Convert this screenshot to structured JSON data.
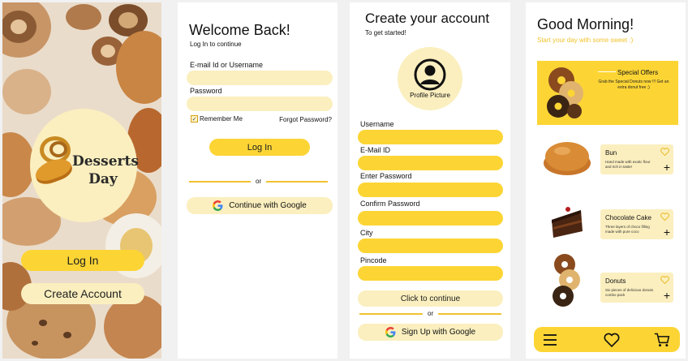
{
  "splash": {
    "brand_line1": "Desserts",
    "brand_line2": "Day",
    "login_label": "Log In",
    "create_label": "Create Account"
  },
  "login": {
    "title": "Welcome Back!",
    "subtitle": "Log In to continue",
    "email_label": "E-mail Id or Username",
    "email_value": "",
    "password_label": "Password",
    "password_value": "",
    "remember_label": "Remember Me",
    "remember_checked": true,
    "forgot_label": "Forgot Password?",
    "login_button": "Log In",
    "or_label": "or",
    "google_button": "Continue with Google"
  },
  "register": {
    "title": "Create your account",
    "subtitle": "To get started!",
    "profile_label": "Profile Picture",
    "fields": [
      {
        "label": "Username",
        "value": ""
      },
      {
        "label": "E-Mail ID",
        "value": ""
      },
      {
        "label": "Enter Password",
        "value": ""
      },
      {
        "label": "Confirm Password",
        "value": ""
      },
      {
        "label": "City",
        "value": ""
      },
      {
        "label": "Pincode",
        "value": ""
      }
    ],
    "continue_button": "Click to continue",
    "or_label": "or",
    "google_button": "Sign Up with Google"
  },
  "home": {
    "greeting": "Good Morning!",
    "greeting_sub": "Start your day with some sweet :)",
    "offer": {
      "title": "Special Offers",
      "description": "Grab the Special Donuts now !!! Get an extra donut free ;)"
    },
    "items": [
      {
        "name": "Bun",
        "description": "Hand made with exotic flour and rich in taste!"
      },
      {
        "name": "Chocolate Cake",
        "description": "Three layers of choco filling made with pure coco"
      },
      {
        "name": "Donuts",
        "description": "Six pieces of delicious donuts combo pack"
      }
    ],
    "nav": [
      "menu-icon",
      "heart-icon",
      "cart-icon"
    ]
  },
  "colors": {
    "accent": "#fcd535",
    "cream": "#fbefbf",
    "sub_text": "#f0c32c"
  }
}
